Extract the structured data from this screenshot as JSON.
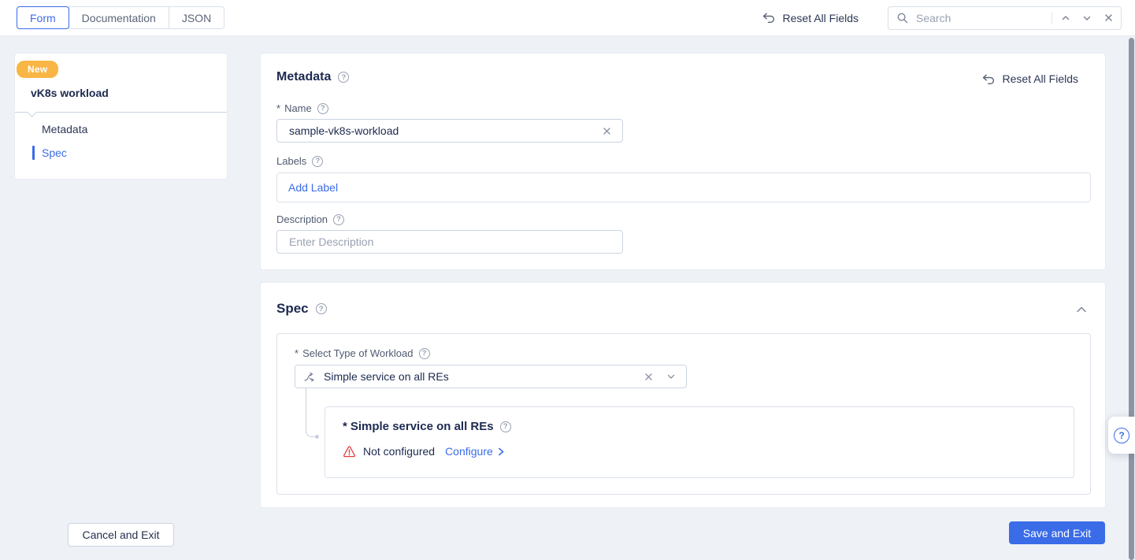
{
  "colors": {
    "accent": "#3b6ce8",
    "badge": "#f9b644",
    "warning": "#e23d3d",
    "page-bg": "#eef1f6"
  },
  "icons": {
    "reset": "undo-arrow",
    "help": "question-circle",
    "search": "magnifier",
    "clear": "x-mark",
    "collapse": "chevron-up",
    "expand": "chevron-down",
    "next": "chevron-right",
    "warning": "triangle-exclamation",
    "workload_type": "branch-arrows"
  },
  "topbar": {
    "tabs": [
      {
        "label": "Form",
        "active": true
      },
      {
        "label": "Documentation",
        "active": false
      },
      {
        "label": "JSON",
        "active": false
      }
    ],
    "reset_all_label": "Reset All Fields",
    "search": {
      "placeholder": "Search"
    }
  },
  "sidebar": {
    "badge": "New",
    "title": "vK8s workload",
    "items": [
      {
        "label": "Metadata",
        "active": false
      },
      {
        "label": "Spec",
        "active": true
      }
    ]
  },
  "metadata": {
    "title": "Metadata",
    "reset_all_label": "Reset All Fields",
    "name_field": {
      "required": "*",
      "label": "Name",
      "value": "sample-vk8s-workload"
    },
    "labels_field": {
      "label": "Labels",
      "add_label": "Add Label"
    },
    "description_field": {
      "label": "Description",
      "placeholder": "Enter Description"
    }
  },
  "spec": {
    "title": "Spec",
    "workload_field": {
      "required": "*",
      "label": "Select Type of Workload",
      "value": "Simple service on all REs"
    },
    "nested": {
      "required": "*",
      "title": "Simple service on all REs",
      "status": "Not configured",
      "action": "Configure"
    }
  },
  "footer": {
    "cancel_label": "Cancel and Exit",
    "save_label": "Save and Exit"
  }
}
